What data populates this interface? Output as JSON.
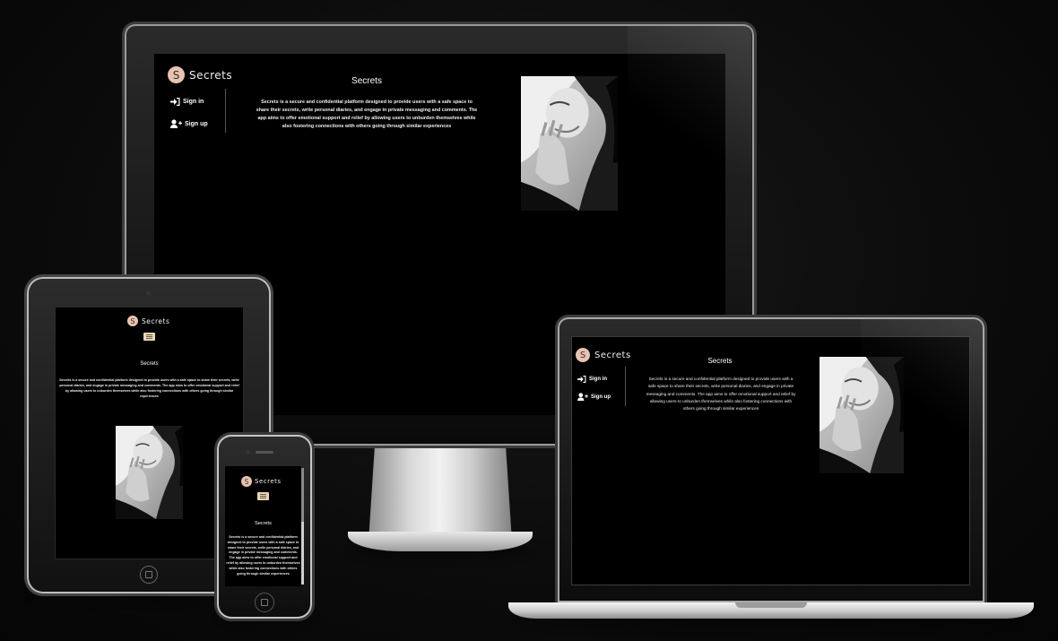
{
  "site": {
    "logo_letter": "S",
    "logo_text": "Secrets",
    "heading": "Secrets",
    "description": "Secrets is a secure and confidential platform designed to provide users with a safe space to share their secrets, write personal diaries, and engage in private messaging and comments. The app aims to offer emotional support and relief by allowing users to unburden themselves while also fostering connections with others going through similar experiences",
    "nav": [
      {
        "label": "Sign in",
        "icon": "sign-in-icon"
      },
      {
        "label": "Sign up",
        "icon": "user-plus-icon"
      }
    ],
    "menu_icon": "hamburger-icon",
    "photo": "woman-portrait-bw"
  },
  "devices": [
    "desktop",
    "tablet",
    "phone",
    "laptop"
  ],
  "colors": {
    "background": "#0b0b0b",
    "screen": "#000000",
    "logo_badge": "#e9c3b1",
    "text": "#ffffff",
    "burger": "#e8d6b8"
  }
}
